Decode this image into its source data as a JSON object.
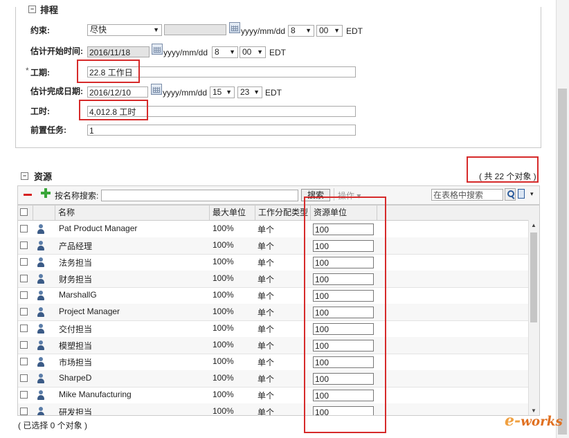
{
  "schedule": {
    "section_title": "排程",
    "constraint_label": "约束:",
    "constraint_value": "尽快",
    "date_format": "yyyy/mm/dd",
    "tz": "EDT",
    "constraint_hour": "8",
    "constraint_min": "00",
    "est_start_label": "估计开始时间:",
    "est_start_value": "2016/11/18",
    "est_start_hour": "8",
    "est_start_min": "00",
    "duration_label": "工期:",
    "duration_required": "*",
    "duration_value": "22.8 工作日",
    "est_finish_label": "估计完成日期:",
    "est_finish_value": "2016/12/10",
    "est_finish_hour": "15",
    "est_finish_min": "23",
    "work_label": "工时:",
    "work_value": "4,012.8 工时",
    "pred_label": "前置任务:",
    "pred_value": "1"
  },
  "resources": {
    "title": "资源",
    "count": "( 共 22 个对象 )",
    "search_label": "按名称搜索:",
    "search_button": "搜索",
    "ops_label": "操作",
    "table_search_placeholder": "在表格中搜索",
    "columns": [
      "名称",
      "最大单位",
      "工作分配类型",
      "资源单位"
    ],
    "rows": [
      {
        "name": "Pat Product Manager",
        "max": "100%",
        "type": "单个",
        "unit": "100"
      },
      {
        "name": "产品经理",
        "max": "100%",
        "type": "单个",
        "unit": "100"
      },
      {
        "name": "法务担当",
        "max": "100%",
        "type": "单个",
        "unit": "100"
      },
      {
        "name": "财务担当",
        "max": "100%",
        "type": "单个",
        "unit": "100"
      },
      {
        "name": "MarshallG",
        "max": "100%",
        "type": "单个",
        "unit": "100"
      },
      {
        "name": "Project Manager",
        "max": "100%",
        "type": "单个",
        "unit": "100"
      },
      {
        "name": "交付担当",
        "max": "100%",
        "type": "单个",
        "unit": "100"
      },
      {
        "name": "模塑担当",
        "max": "100%",
        "type": "单个",
        "unit": "100"
      },
      {
        "name": "市场担当",
        "max": "100%",
        "type": "单个",
        "unit": "100"
      },
      {
        "name": "SharpeD",
        "max": "100%",
        "type": "单个",
        "unit": "100"
      },
      {
        "name": "Mike Manufacturing",
        "max": "100%",
        "type": "单个",
        "unit": "100"
      },
      {
        "name": "研发担当",
        "max": "100%",
        "type": "单个",
        "unit": "100"
      }
    ],
    "footer": "( 已选择 0 个对象 )"
  },
  "watermark": {
    "main": "e-works"
  },
  "colors": {
    "highlight": "#d62a2a"
  }
}
